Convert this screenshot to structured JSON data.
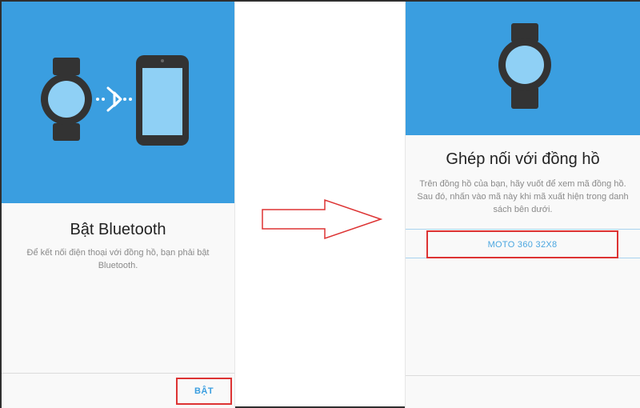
{
  "left_screen": {
    "title": "Bật Bluetooth",
    "description": "Để kết nối điện thoại với đồng hồ, bạn phải bật Bluetooth.",
    "button_label": "BẬT",
    "illustration_icons": [
      "watch-icon",
      "bluetooth-icon",
      "phone-icon"
    ]
  },
  "right_screen": {
    "title": "Ghép nối với đồng hồ",
    "description": "Trên đồng hồ của bạn, hãy vuốt để xem mã đồng hồ. Sau đó, nhấn vào mã này khi mã xuất hiện trong danh sách bên dưới.",
    "device_name": "MOTO 360 32X8",
    "illustration_icons": [
      "watch-icon"
    ]
  },
  "colors": {
    "hero_blue": "#3a9ee0",
    "highlight_red": "#dd3333",
    "link_blue": "#3a9ee0"
  }
}
